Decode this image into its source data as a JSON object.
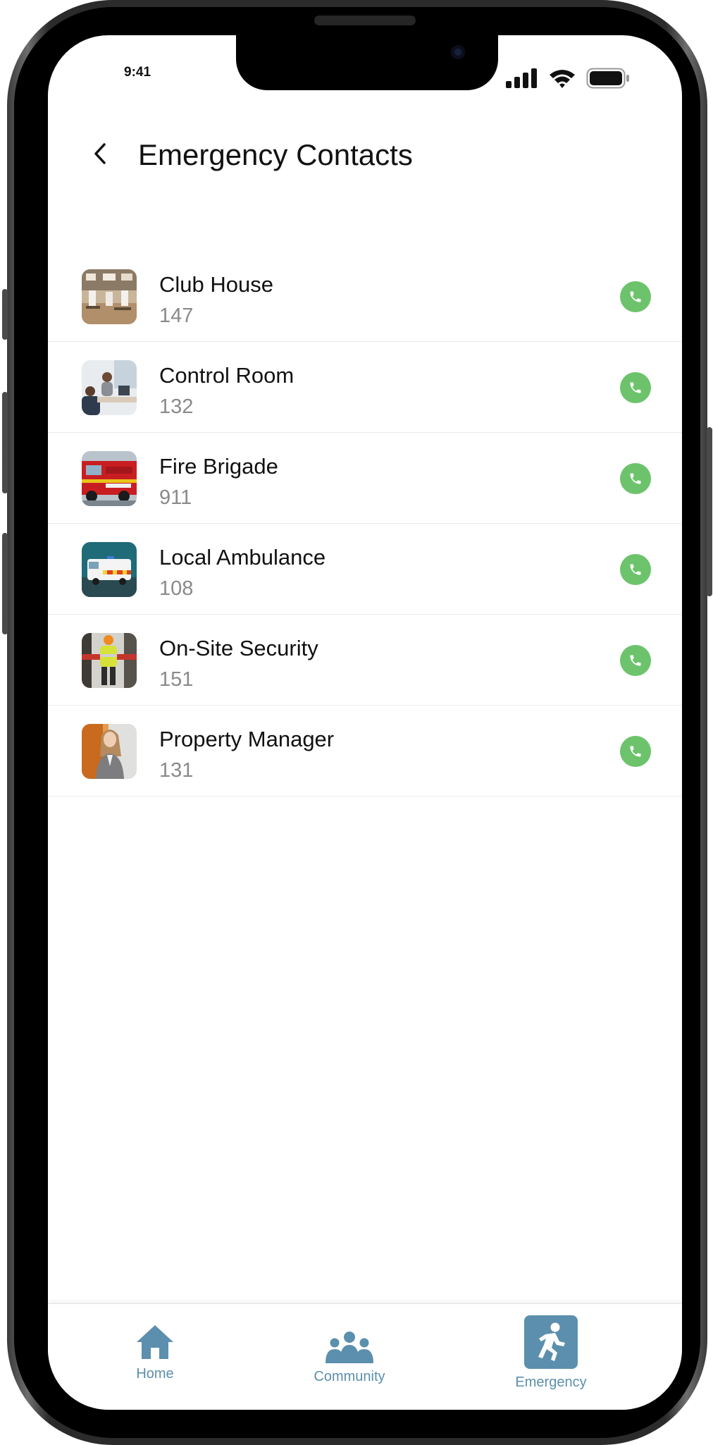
{
  "status_bar": {
    "time": "9:41"
  },
  "header": {
    "title": "Emergency Contacts",
    "back_icon": "chevron-left-icon"
  },
  "contacts": [
    {
      "name": "Club House",
      "number": "147",
      "thumbnail": "clubhouse-photo"
    },
    {
      "name": "Control Room",
      "number": "132",
      "thumbnail": "control-room-photo"
    },
    {
      "name": "Fire Brigade",
      "number": "911",
      "thumbnail": "fire-truck-photo"
    },
    {
      "name": "Local Ambulance",
      "number": "108",
      "thumbnail": "ambulance-photo"
    },
    {
      "name": "On-Site Security",
      "number": "151",
      "thumbnail": "security-guard-photo"
    },
    {
      "name": "Property Manager",
      "number": "131",
      "thumbnail": "manager-photo"
    }
  ],
  "bottom_nav": {
    "items": [
      {
        "label": "Home",
        "icon": "home-icon"
      },
      {
        "label": "Community",
        "icon": "community-icon"
      },
      {
        "label": "Emergency",
        "icon": "running-person-icon",
        "active": true
      }
    ]
  },
  "colors": {
    "call_button": "#6cc36b",
    "nav_accent": "#5b8fad",
    "title_text": "#111111",
    "number_text": "#8a8a8a"
  }
}
